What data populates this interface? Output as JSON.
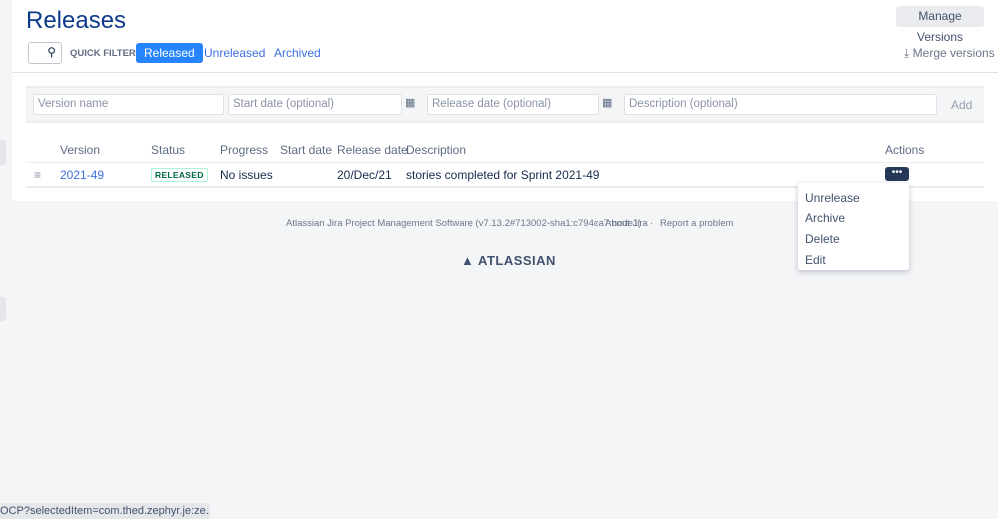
{
  "header": {
    "title": "Releases",
    "manage_versions": "Manage Versions",
    "merge_versions": "Merge versions",
    "merge_icon": "⤓"
  },
  "filters": {
    "search_icon": "🔍",
    "label": "QUICK FILTERS:",
    "items": [
      "Released",
      "Unreleased",
      "Archived"
    ]
  },
  "form": {
    "version_placeholder": "Version name",
    "start_placeholder": "Start date (optional)",
    "release_placeholder": "Release date (optional)",
    "description_placeholder": "Description (optional)",
    "add": "Add",
    "calendar_icon": "▦"
  },
  "table": {
    "headers": [
      "Version",
      "Status",
      "Progress",
      "Start date",
      "Release date",
      "Description",
      "Actions"
    ],
    "rows": [
      {
        "version": "2021-49",
        "status": "RELEASED",
        "progress": "No issues",
        "start_date": "",
        "release_date": "20/Dec/21",
        "description": "stories completed for Sprint 2021-49",
        "actions": "•••"
      }
    ]
  },
  "menu": [
    "Unrelease",
    "Archive",
    "Delete",
    "Edit"
  ],
  "footer": {
    "software": "Atlassian Jira Project Management Software (v7.13.2#713002-sha1:c794ca7:node1)",
    "sep": "·",
    "about": "About Jira",
    "report": "Report a problem",
    "logo": "ATLASSIAN"
  },
  "statusbar": "OCP?selectedItem=com.thed.zephyr.je:ze..."
}
